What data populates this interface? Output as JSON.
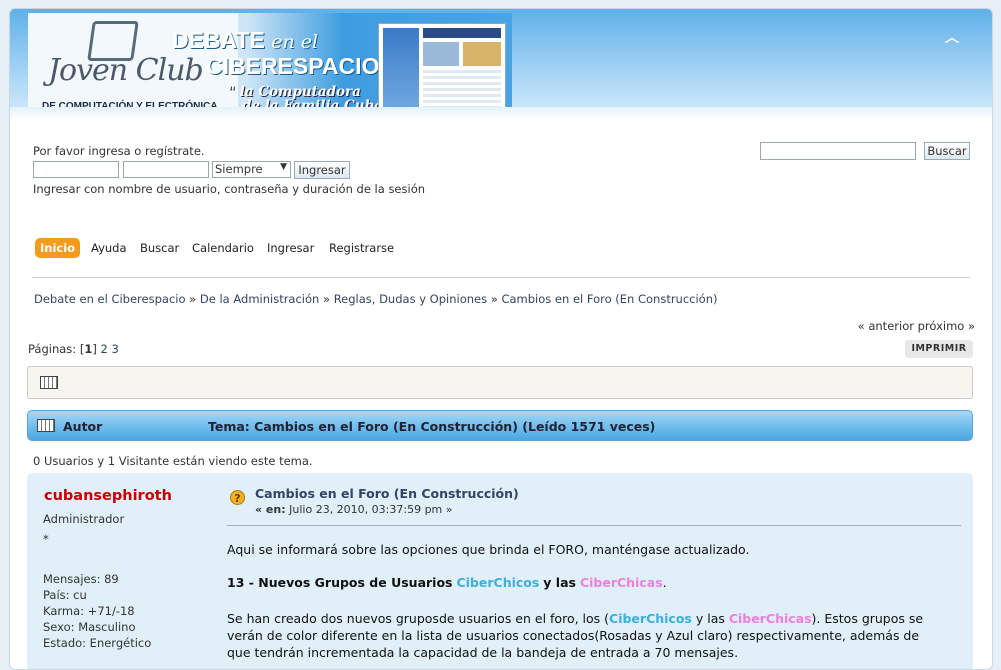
{
  "header": {
    "logo_script": "Joven Club",
    "logo_sub": "DE COMPUTACIÓN Y ELECTRÓNICA",
    "title_debate": "DEBATE",
    "title_en_el": "en el",
    "title_ciberespacio": "CIBERESPACIO",
    "slogan_line1": "\" la Computadora",
    "slogan_line2": "de la Familia Cubana \""
  },
  "login": {
    "prompt": "Por favor ingresa o regístrate.",
    "duration_value": "Siempre",
    "login_button": "Ingresar",
    "hint": "Ingresar con nombre de usuario, contraseña y duración de la sesión"
  },
  "search": {
    "button": "Buscar"
  },
  "menu": {
    "items": [
      "Inicio",
      "Ayuda",
      "Buscar",
      "Calendario",
      "Ingresar",
      "Registrarse"
    ]
  },
  "breadcrumb": {
    "items": [
      "Debate en el Ciberespacio",
      "De la Administración",
      "Reglas, Dudas y Opiniones",
      "Cambios en el Foro (En Construcción)"
    ],
    "sep": "»"
  },
  "pagination": {
    "prev_next": "« anterior próximo »",
    "label": "Páginas:",
    "current": "1",
    "pages": [
      "2",
      "3"
    ],
    "print": "IMPRIMIR"
  },
  "topic_header": {
    "author": "Autor",
    "topic": "Tema: Cambios en el Foro (En Construcción)  (Leído 1571 veces)"
  },
  "viewers": "0 Usuarios y 1 Visitante están viendo este tema.",
  "post": {
    "username": "cubansephiroth",
    "rank": "Administrador",
    "star": "*",
    "stats": [
      "Mensajes: 89",
      "País: cu",
      "Karma: +71/-18",
      "Sexo: Masculino",
      "Estado: Energético"
    ],
    "subject": "Cambios en el Foro (En Construcción)",
    "date_prefix": "« en:",
    "date": "Julio 23, 2010, 03:37:59 pm »",
    "line1": "Aqui se informará sobre las opciones que brinda el FORO, manténgase actualizado.",
    "heading_pre": "13 - Nuevos Grupos de Usuarios",
    "heading_blue": "CiberChicos",
    "heading_mid": "y las",
    "heading_pink": "CiberChicas",
    "heading_end": ".",
    "para_pre": "Se han creado dos nuevos gruposde usuarios  en el foro, los (",
    "para_blue": "CiberChicos",
    "para_mid": " y las ",
    "para_pink": "CiberChicas",
    "para_post": "). Estos grupos se",
    "para_line2": "verán de color diferente en la lista de usuarios conectados(Rosadas y Azul claro) respectivamente, además de",
    "para_line3": "que tendrán incrementada la capacidad de la bandeja de entrada a 70 mensajes."
  },
  "colors": {
    "active_menu": "#f59a1a",
    "username": "#cc0000",
    "ciberchicos": "#3ab0e0",
    "ciberchicas": "#f07ee0",
    "titlebar": "#6fbcec"
  }
}
